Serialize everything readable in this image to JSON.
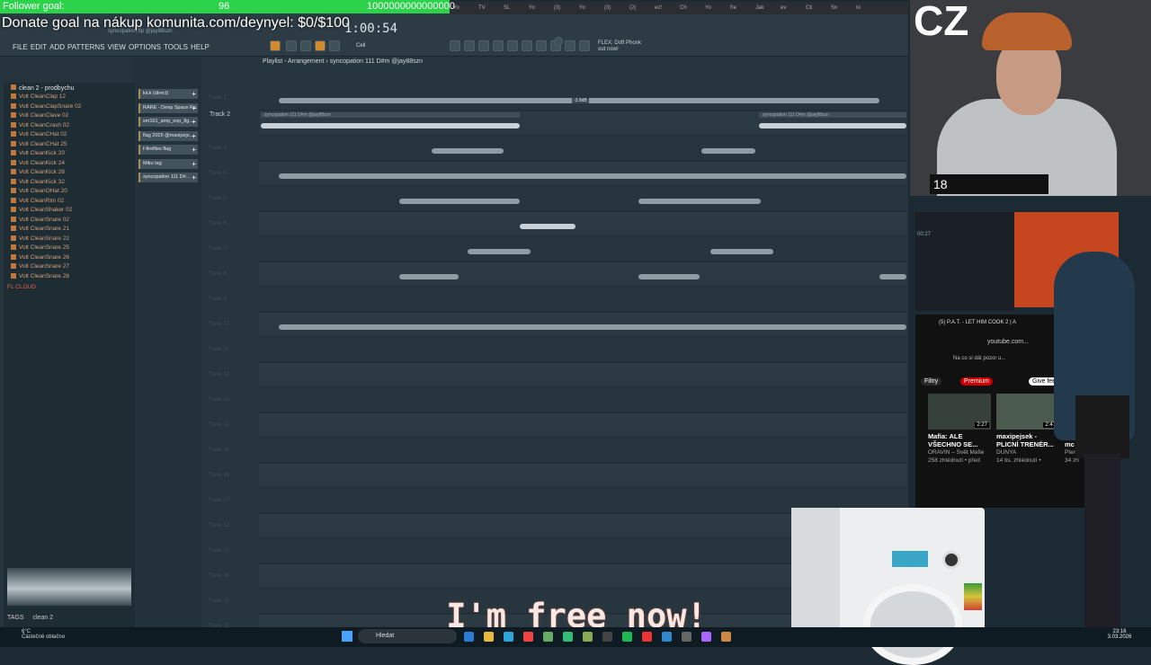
{
  "overlay": {
    "follower_label": "Follower goal:",
    "follower_count": "96",
    "follower_target": "1000000000000000",
    "donate": "Donate goal na nákup komunita.com/deynyel: $0/$100"
  },
  "fl": {
    "menu": [
      "FILE",
      "EDIT",
      "ADD",
      "PATTERNS",
      "VIEW",
      "OPTIONS",
      "TOOLS",
      "HELP"
    ],
    "project_hint": "syncopation.flp @jay88szn",
    "time": "1:00:54",
    "hint_title": "FLEX: Drift Phonk",
    "hint_sub": "out now!",
    "cell_label": "Cell",
    "playlist_title": "Playlist - Arrangement › syncopation 111 D#m @jay88szn",
    "tabs": [
      "Yo",
      "TV",
      "SL",
      "Yo",
      "(3)",
      "Yo",
      "(3)",
      "(2(",
      "ez!",
      "Ch",
      "Yo",
      "fre",
      "Jak",
      "ev",
      "Cti",
      "Sn",
      "to"
    ]
  },
  "browser": {
    "folder": "clean 2 - prodbychu",
    "items": [
      "Volt CleanClap 12",
      "Volt CleanClapSnare 02",
      "Volt CleanClave 02",
      "Volt CleanCrash 02",
      "Volt CleanCHat 02",
      "Volt CleanCHat 25",
      "Volt CleanKick 20",
      "Volt CleanKick 24",
      "Volt CleanKick 26",
      "Volt CleanKick 32",
      "Volt CleanOHat 20",
      "Volt CleanRim 02",
      "Volt CleanShaker 02",
      "Volt CleanSnare 02",
      "Volt CleanSnare 21",
      "Volt CleanSnare 22",
      "Volt CleanSnare 25",
      "Volt CleanSnare 26",
      "Volt CleanSnare 27",
      "Volt CleanSnare 28"
    ],
    "cloud": "FL CLOUD",
    "tags_label": "TAGS",
    "tags_value": "clean 2"
  },
  "patterns": [
    "kick (direct)",
    "RARE - Deep Space Re...",
    "sm101_amp_exp_8g...",
    "flag 2025 @maxipejs...",
    "f-fireflies flag",
    "Miku tag",
    "syncopation 111 D#..."
  ],
  "playlist": {
    "track_label": "Track 2",
    "clip_name": "syncopation 111 D#m @jay88szn",
    "db_readout": "-3.9dB",
    "track_numbers": [
      "Track 1",
      "Track 2",
      "Track 3",
      "Track 4",
      "Track 5",
      "Track 6",
      "Track 7",
      "Track 8",
      "Track 9",
      "Track 10",
      "Track 11",
      "Track 12",
      "Track 13",
      "Track 14",
      "Track 15",
      "Track 16",
      "Track 17",
      "Track 18",
      "Track 19",
      "Track 20",
      "Track 21",
      "Track 22"
    ]
  },
  "webcam": {
    "logo": "CZ",
    "badges": "18"
  },
  "browser_window": {
    "time": "00:27",
    "tab_title": "(5) P.A.T. - LET HIM COOK 2 | A",
    "url": "youtube.com...",
    "bookmark": "Na co si dát pozor u...",
    "chips": [
      "Filtry",
      "Premium",
      "Give feedback"
    ],
    "videos": [
      {
        "title": "Mafia: ALE VŠECHNO SE...",
        "channel": "ORAVIN – Svět Mafie",
        "meta": "258 zhlédnutí • před",
        "duration": "2:27"
      },
      {
        "title": "maxipejsek - PLICNÍ TRENÉR...",
        "channel": "DUNYA",
        "meta": "14 tis. zhlédnutí •",
        "duration": "2:47"
      },
      {
        "title": "Přijd | mc",
        "channel": "Ptero",
        "meta": "34 zh",
        "duration": ""
      }
    ]
  },
  "subtitle": "I'm free now!",
  "taskbar": {
    "temp": "6°C",
    "weather": "Částečně oblačno",
    "search": "Hledat",
    "time": "23:16",
    "date": "3.03.2026"
  },
  "colors": {
    "follower_bar": "#2bd24a",
    "fl_bg": "#26353d",
    "browser_item": "#d4a07a",
    "subtitle": "#f8e7e2"
  }
}
